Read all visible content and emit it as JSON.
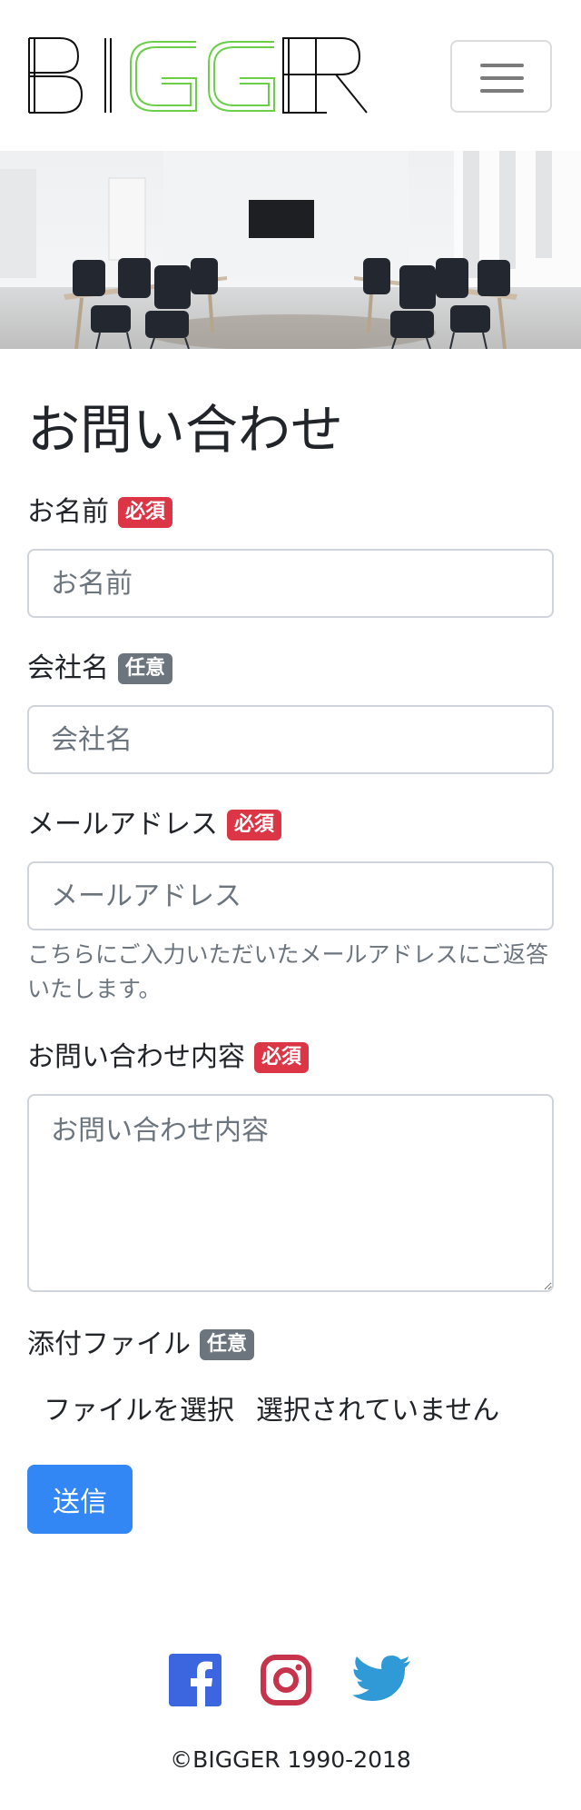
{
  "header": {
    "logo": {
      "letters": [
        "B",
        "I",
        "G",
        "G",
        "E",
        "R"
      ],
      "letter_colors": [
        "#111111",
        "#111111",
        "#6ccf4a",
        "#6ccf4a",
        "#111111",
        "#111111"
      ]
    },
    "menu_icon": "hamburger-icon"
  },
  "hero": {
    "image_description": "office-room"
  },
  "form": {
    "title": "お問い合わせ",
    "name": {
      "label": "お名前",
      "badge": "必須",
      "placeholder": "お名前"
    },
    "company": {
      "label": "会社名",
      "badge": "任意",
      "placeholder": "会社名"
    },
    "email": {
      "label": "メールアドレス",
      "badge": "必須",
      "placeholder": "メールアドレス",
      "help": "こちらにご入力いただいたメールアドレスにご返答いたします。"
    },
    "message": {
      "label": "お問い合わせ内容",
      "badge": "必須",
      "placeholder": "お問い合わせ内容"
    },
    "attachment": {
      "label": "添付ファイル",
      "badge": "任意",
      "button": "ファイルを選択",
      "status": "選択されていません"
    },
    "submit_label": "送信"
  },
  "footer": {
    "social": [
      {
        "icon": "facebook-icon",
        "color": "#3b66e0"
      },
      {
        "icon": "instagram-icon",
        "color": "#c8334c"
      },
      {
        "icon": "twitter-icon",
        "color": "#2f9ad6"
      }
    ],
    "copyright": "©BIGGER 1990-2018"
  },
  "colors": {
    "required": "#dc3545",
    "optional": "#6c757d",
    "primary": "#3287f5",
    "accent": "#6ccf4a"
  }
}
